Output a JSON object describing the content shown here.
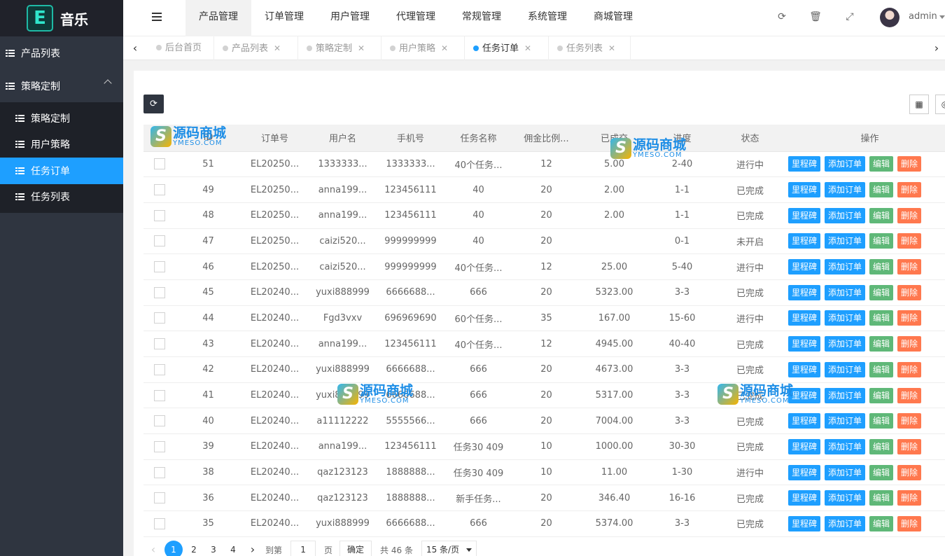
{
  "app": {
    "logo_letter": "E",
    "title": "音乐"
  },
  "sidebar": {
    "items": [
      {
        "label": "产品列表"
      },
      {
        "label": "策略定制"
      }
    ],
    "sub_items": [
      {
        "label": "策略定制"
      },
      {
        "label": "用户策略"
      },
      {
        "label": "任务订单"
      },
      {
        "label": "任务列表"
      }
    ],
    "active_sub": "任务订单"
  },
  "header": {
    "tabs": [
      "产品管理",
      "订单管理",
      "用户管理",
      "代理管理",
      "常规管理",
      "系统管理",
      "商城管理"
    ],
    "active_tab": "产品管理",
    "icons": [
      "refresh-icon",
      "trash-icon",
      "fullscreen-icon"
    ],
    "user": "admin"
  },
  "page_tabs": [
    {
      "label": "后台首页",
      "closable": false
    },
    {
      "label": "产品列表",
      "closable": true
    },
    {
      "label": "策略定制",
      "closable": true
    },
    {
      "label": "用户策略",
      "closable": true
    },
    {
      "label": "任务订单",
      "closable": true,
      "active": true
    },
    {
      "label": "任务列表",
      "closable": true
    }
  ],
  "table": {
    "headers": [
      "",
      "ID",
      "订单号",
      "用户名",
      "手机号",
      "任务名称",
      "佣金比例...",
      "已成交",
      "进度",
      "状态",
      "操作"
    ],
    "actions": [
      "里程碑",
      "添加订单",
      "编辑",
      "删除"
    ],
    "rows": [
      [
        "51",
        "EL20250...",
        "1333333...",
        "1333333...",
        "40个任务...",
        "12",
        "5.00",
        "2-40",
        "进行中"
      ],
      [
        "49",
        "EL20250...",
        "anna199...",
        "123456111",
        "40",
        "20",
        "2.00",
        "1-1",
        "已完成"
      ],
      [
        "48",
        "EL20250...",
        "anna199...",
        "123456111",
        "40",
        "20",
        "2.00",
        "1-1",
        "已完成"
      ],
      [
        "47",
        "EL20250...",
        "caizi520...",
        "999999999",
        "40",
        "20",
        "",
        "0-1",
        "未开启"
      ],
      [
        "46",
        "EL20250...",
        "caizi520...",
        "999999999",
        "40个任务...",
        "12",
        "25.00",
        "5-40",
        "进行中"
      ],
      [
        "45",
        "EL20240...",
        "yuxi888999",
        "6666688...",
        "666",
        "20",
        "5323.00",
        "3-3",
        "已完成"
      ],
      [
        "44",
        "EL20240...",
        "Fgd3vxv",
        "696969690",
        "60个任务...",
        "35",
        "167.00",
        "15-60",
        "进行中"
      ],
      [
        "43",
        "EL20240...",
        "anna199...",
        "123456111",
        "40个任务...",
        "12",
        "4945.00",
        "40-40",
        "已完成"
      ],
      [
        "42",
        "EL20240...",
        "yuxi888999",
        "6666688...",
        "666",
        "20",
        "4673.00",
        "3-3",
        "已完成"
      ],
      [
        "41",
        "EL20240...",
        "yuxi888999",
        "6666688...",
        "666",
        "20",
        "5317.00",
        "3-3",
        "已完成"
      ],
      [
        "40",
        "EL20240...",
        "a11112222",
        "5555566...",
        "666",
        "20",
        "7004.00",
        "3-3",
        "已完成"
      ],
      [
        "39",
        "EL20240...",
        "anna199...",
        "123456111",
        "任务30 409",
        "10",
        "1000.00",
        "30-30",
        "已完成"
      ],
      [
        "38",
        "EL20240...",
        "qaz123123",
        "1888888...",
        "任务30 409",
        "10",
        "11.00",
        "1-30",
        "进行中"
      ],
      [
        "36",
        "EL20240...",
        "qaz123123",
        "1888888...",
        "新手任务...",
        "20",
        "346.40",
        "16-16",
        "已完成"
      ],
      [
        "35",
        "EL20240...",
        "yuxi888999",
        "6666688...",
        "666",
        "20",
        "5374.00",
        "3-3",
        "已完成"
      ]
    ]
  },
  "watermark": {
    "cn": "源码商城",
    "en": "YMESO.COM"
  },
  "pager": {
    "pages": [
      "1",
      "2",
      "3",
      "4"
    ],
    "current": "1",
    "goto_label": "到第",
    "goto_value": "1",
    "page_unit": "页",
    "confirm": "确定",
    "total": "共 46 条",
    "page_size": "15 条/页"
  },
  "colors": {
    "accent": "#1e9fff",
    "sidebar": "#2f3540",
    "green": "#5fb878",
    "red": "#ff5722"
  }
}
